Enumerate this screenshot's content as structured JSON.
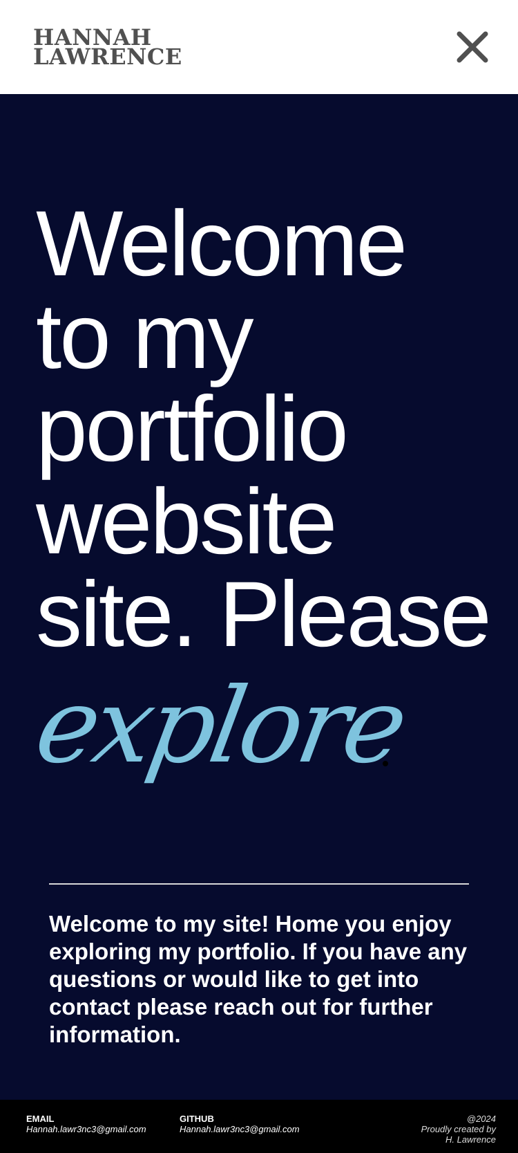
{
  "header": {
    "logo_line1": "HANNAH",
    "logo_line2": "LAWRENCE",
    "close_icon": "close-icon"
  },
  "hero": {
    "headline_lines": [
      "Welcome",
      "to my",
      "portfolio",
      "website",
      "site. Please"
    ],
    "script_word": "explore",
    "script_color": "#7ec3de",
    "background": "#060b2e"
  },
  "intro": {
    "text": "Welcome to my site!  Home you enjoy exploring my portfolio. If you have any questions or would like to get into contact please reach out for further information."
  },
  "footer": {
    "email_label": "EMAIL",
    "email_value": "Hannah.lawr3nc3@gmail.com",
    "github_label": "GITHUB",
    "github_value": "Hannah.lawr3nc3@gmail.com",
    "credit_year": "@2024",
    "credit_line1": "Proudly created by",
    "credit_line2": "H. Lawrence"
  }
}
